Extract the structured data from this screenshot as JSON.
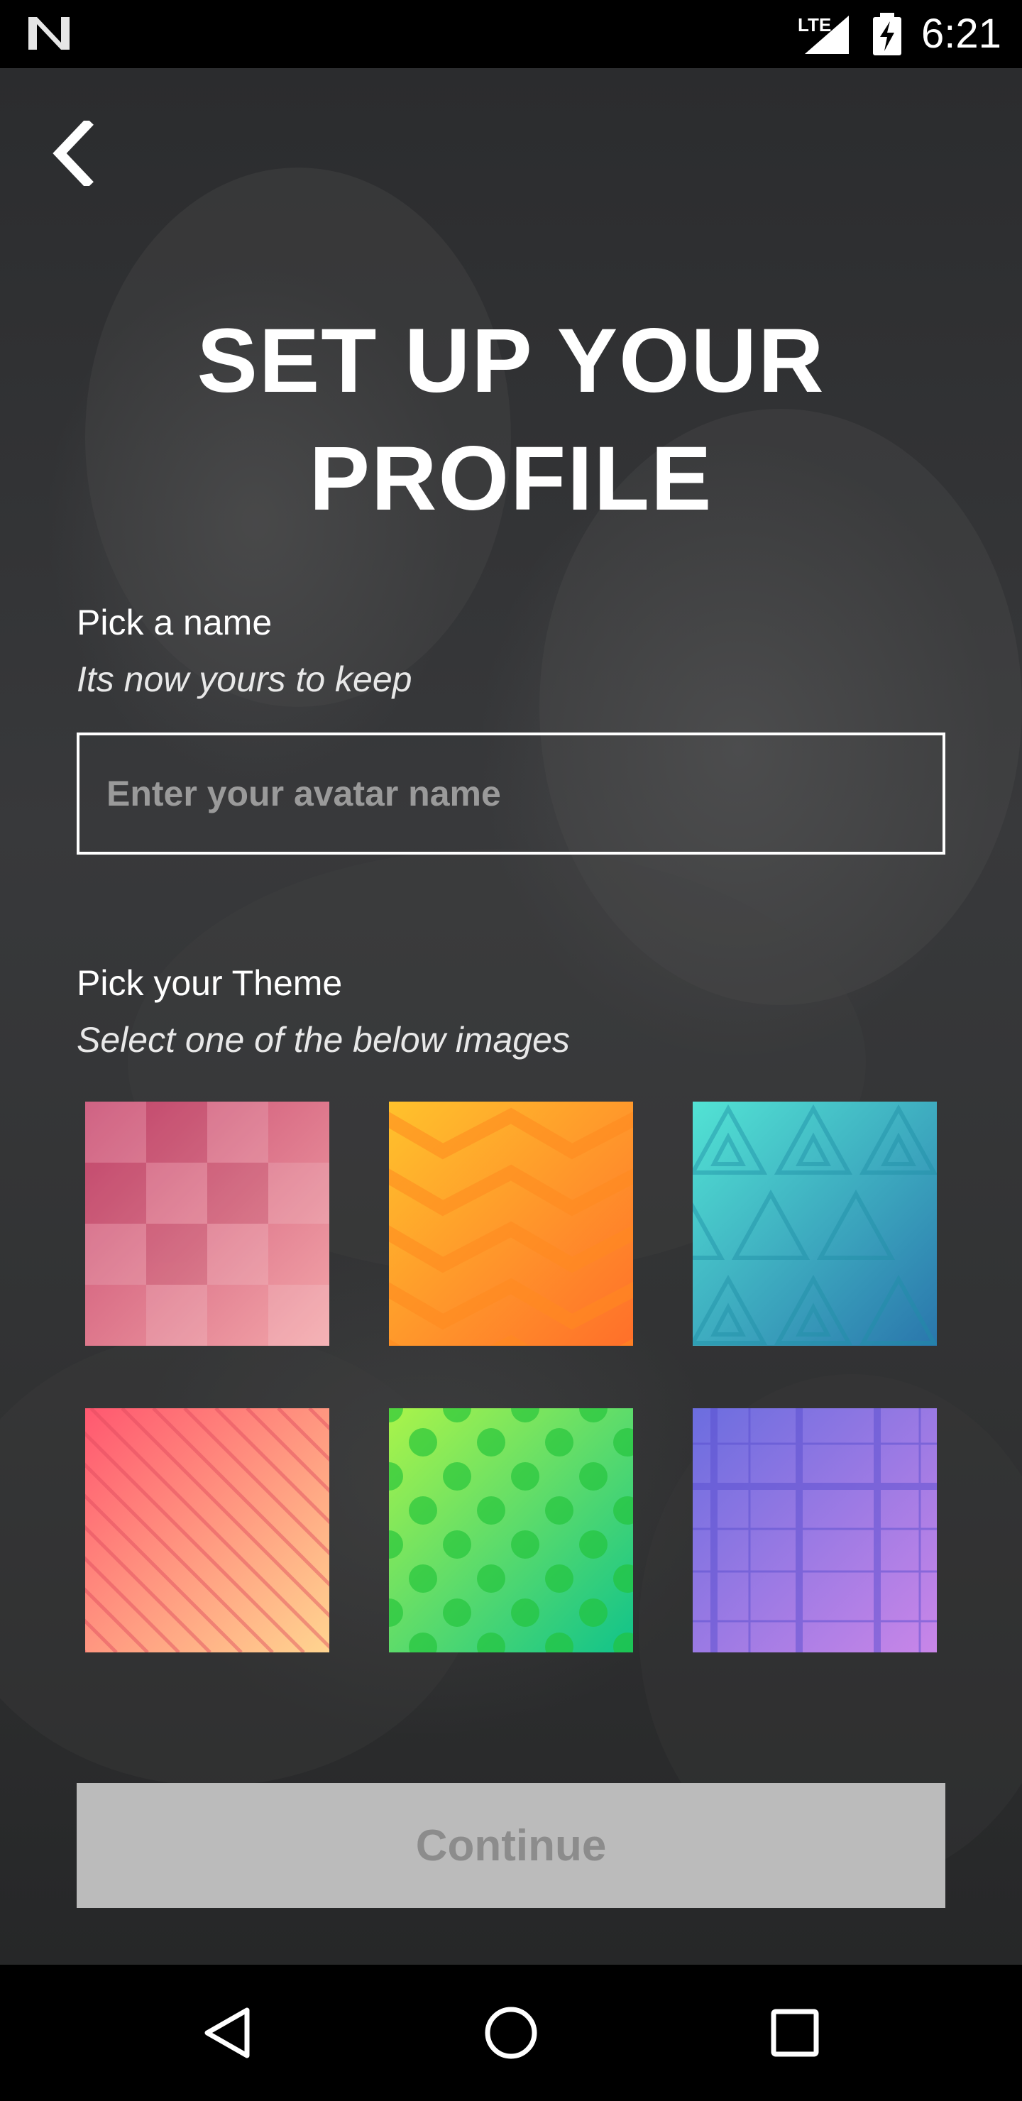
{
  "status_bar": {
    "network": "LTE",
    "time": "6:21"
  },
  "header": {
    "back_icon": "chevron-left-icon",
    "title_line1": "SET UP YOUR",
    "title_line2": "PROFILE"
  },
  "name_section": {
    "label": "Pick a name",
    "subtitle": "Its now yours to keep",
    "input_placeholder": "Enter your avatar name",
    "input_value": ""
  },
  "theme_section": {
    "label": "Pick your Theme",
    "subtitle": "Select one of the below images",
    "themes": [
      {
        "name": "pink-checker",
        "colors": [
          "#c8496f",
          "#f4a2a8"
        ]
      },
      {
        "name": "orange-chevron",
        "colors": [
          "#ffbf2b",
          "#ff7a2a"
        ]
      },
      {
        "name": "teal-triangles",
        "colors": [
          "#4fe0d4",
          "#2a7fb0"
        ]
      },
      {
        "name": "coral-stripes",
        "colors": [
          "#ff5a6e",
          "#ffd28e"
        ]
      },
      {
        "name": "green-dots",
        "colors": [
          "#a8f54a",
          "#14c48a"
        ]
      },
      {
        "name": "purple-plaid",
        "colors": [
          "#6f6ce0",
          "#c885e8"
        ]
      }
    ]
  },
  "continue_button": {
    "label": "Continue",
    "enabled": false
  },
  "nav_bar": {
    "back": "back-triangle-icon",
    "home": "home-circle-icon",
    "recents": "recents-square-icon"
  }
}
